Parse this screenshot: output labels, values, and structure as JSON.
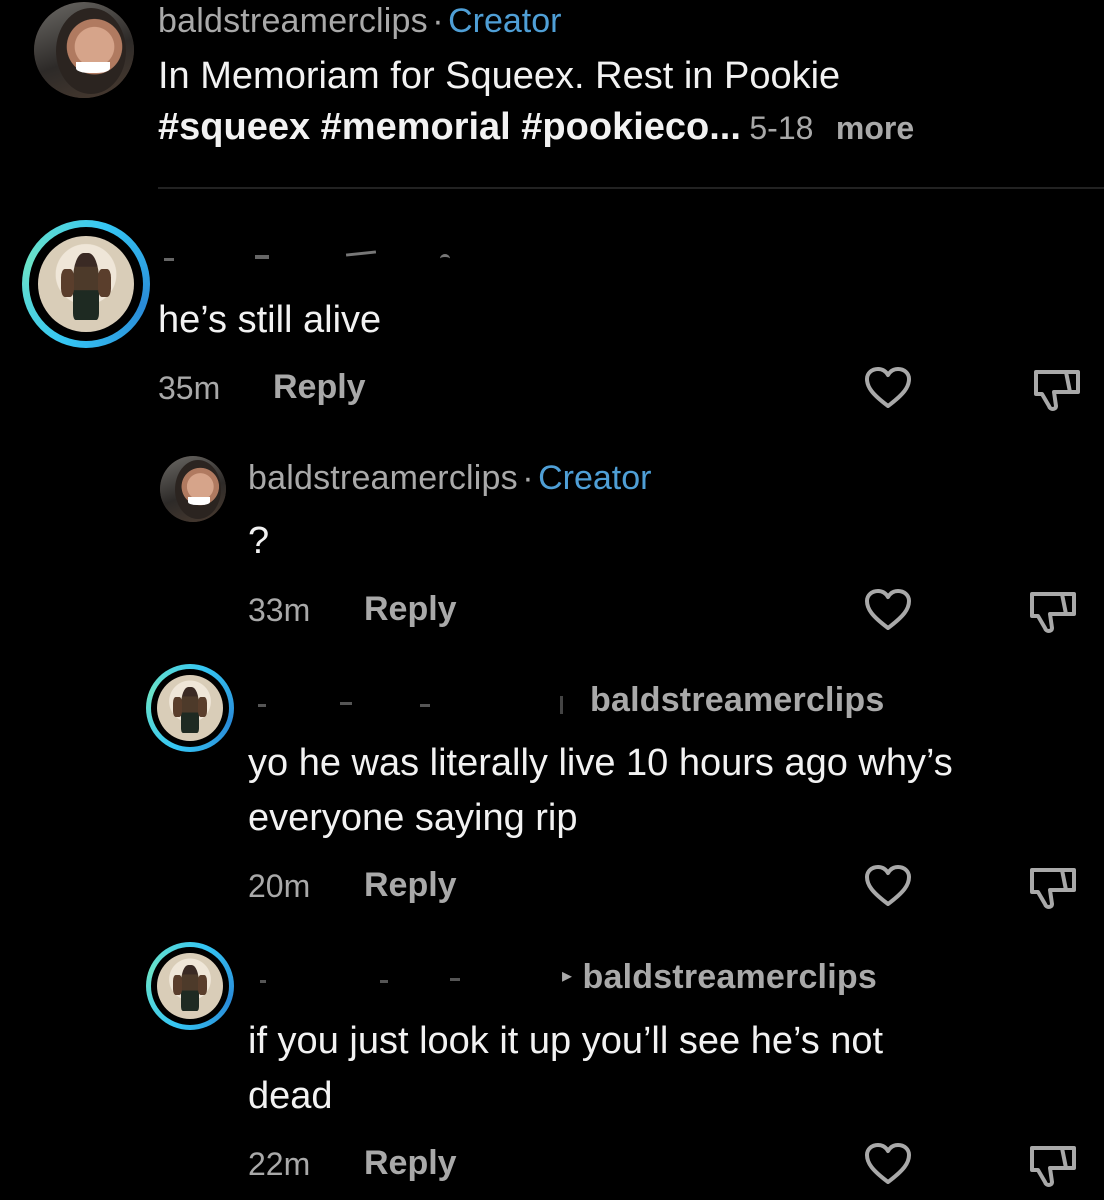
{
  "post": {
    "author": "baldstreamerclips",
    "separator": "·",
    "author_badge": "Creator",
    "caption_line1": "In Memoriam for Squeex. Rest in Pookie",
    "caption_line2": "#squeex #memorial #pookieco...",
    "date": "5-18",
    "more_label": "more"
  },
  "comments": [
    {
      "text": "he’s still alive",
      "time": "35m",
      "reply_label": "Reply"
    },
    {
      "author": "baldstreamerclips",
      "separator": "·",
      "author_badge": "Creator",
      "text": "?",
      "time": "33m",
      "reply_label": "Reply"
    },
    {
      "reply_to": "baldstreamerclips",
      "text_line1": "yo he was literally live 10 hours ago why’s",
      "text_line2": "everyone saying rip",
      "time": "20m",
      "reply_label": "Reply"
    },
    {
      "reply_to": "baldstreamerclips",
      "text_line1": "if you just look it up you’ll see he’s not",
      "text_line2": "dead",
      "time": "22m",
      "reply_label": "Reply"
    }
  ],
  "icons": {
    "like": "heart-outline-icon",
    "dislike": "thumbs-down-outline-icon",
    "reply_arrow": "caret-right-icon"
  },
  "colors": {
    "background": "#000000",
    "creator_badge": "#4f9fd6",
    "story_ring": "#35c6f4",
    "muted_text": "#a9a9a9"
  }
}
